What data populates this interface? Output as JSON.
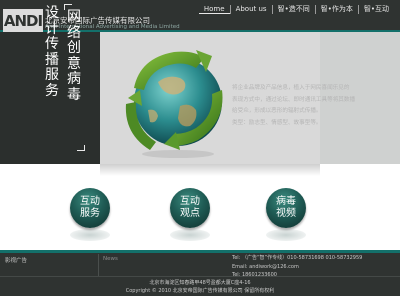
{
  "header": {
    "logo_text": "ANDI",
    "company_cn": "北京安帝国际广告传媒有限公司",
    "company_en": "Andi International Advertising and Media Limited",
    "nav": [
      {
        "label": "Home",
        "active": true
      },
      {
        "label": "About us",
        "active": false
      },
      {
        "label": "智•造不同",
        "active": false
      },
      {
        "label": "智•作为本",
        "active": false
      },
      {
        "label": "智•互动",
        "active": false
      }
    ]
  },
  "hero": {
    "title_col1": "设计传播服务",
    "title_col2": "网络创意病毒",
    "description": [
      "将企业品牌及产品信息，植入于网民喜闻乐见的",
      "表现方式中，通过论坛、即时通讯工具等将其数播",
      "给受众，形成以恶形的辐射式传播。",
      "类型：励志型、情感型、故事型等。"
    ]
  },
  "services": [
    {
      "label": "互动服务"
    },
    {
      "label": "互动观点"
    },
    {
      "label": "病毒视频"
    }
  ],
  "footer": {
    "left_label": "影视广告",
    "news_label": "News",
    "contact": [
      "Tel: （广告“智”作专线）010-58731698 010-58732959",
      "Email: andiwork@126.com",
      "Tel: 18601233600"
    ],
    "address": "北京市海淀区知春路甲48号盈都大厦C座4-16",
    "copyright": "Copyright © 2010 北京安帝国际广告传媒有限公司 保留所有权利"
  }
}
